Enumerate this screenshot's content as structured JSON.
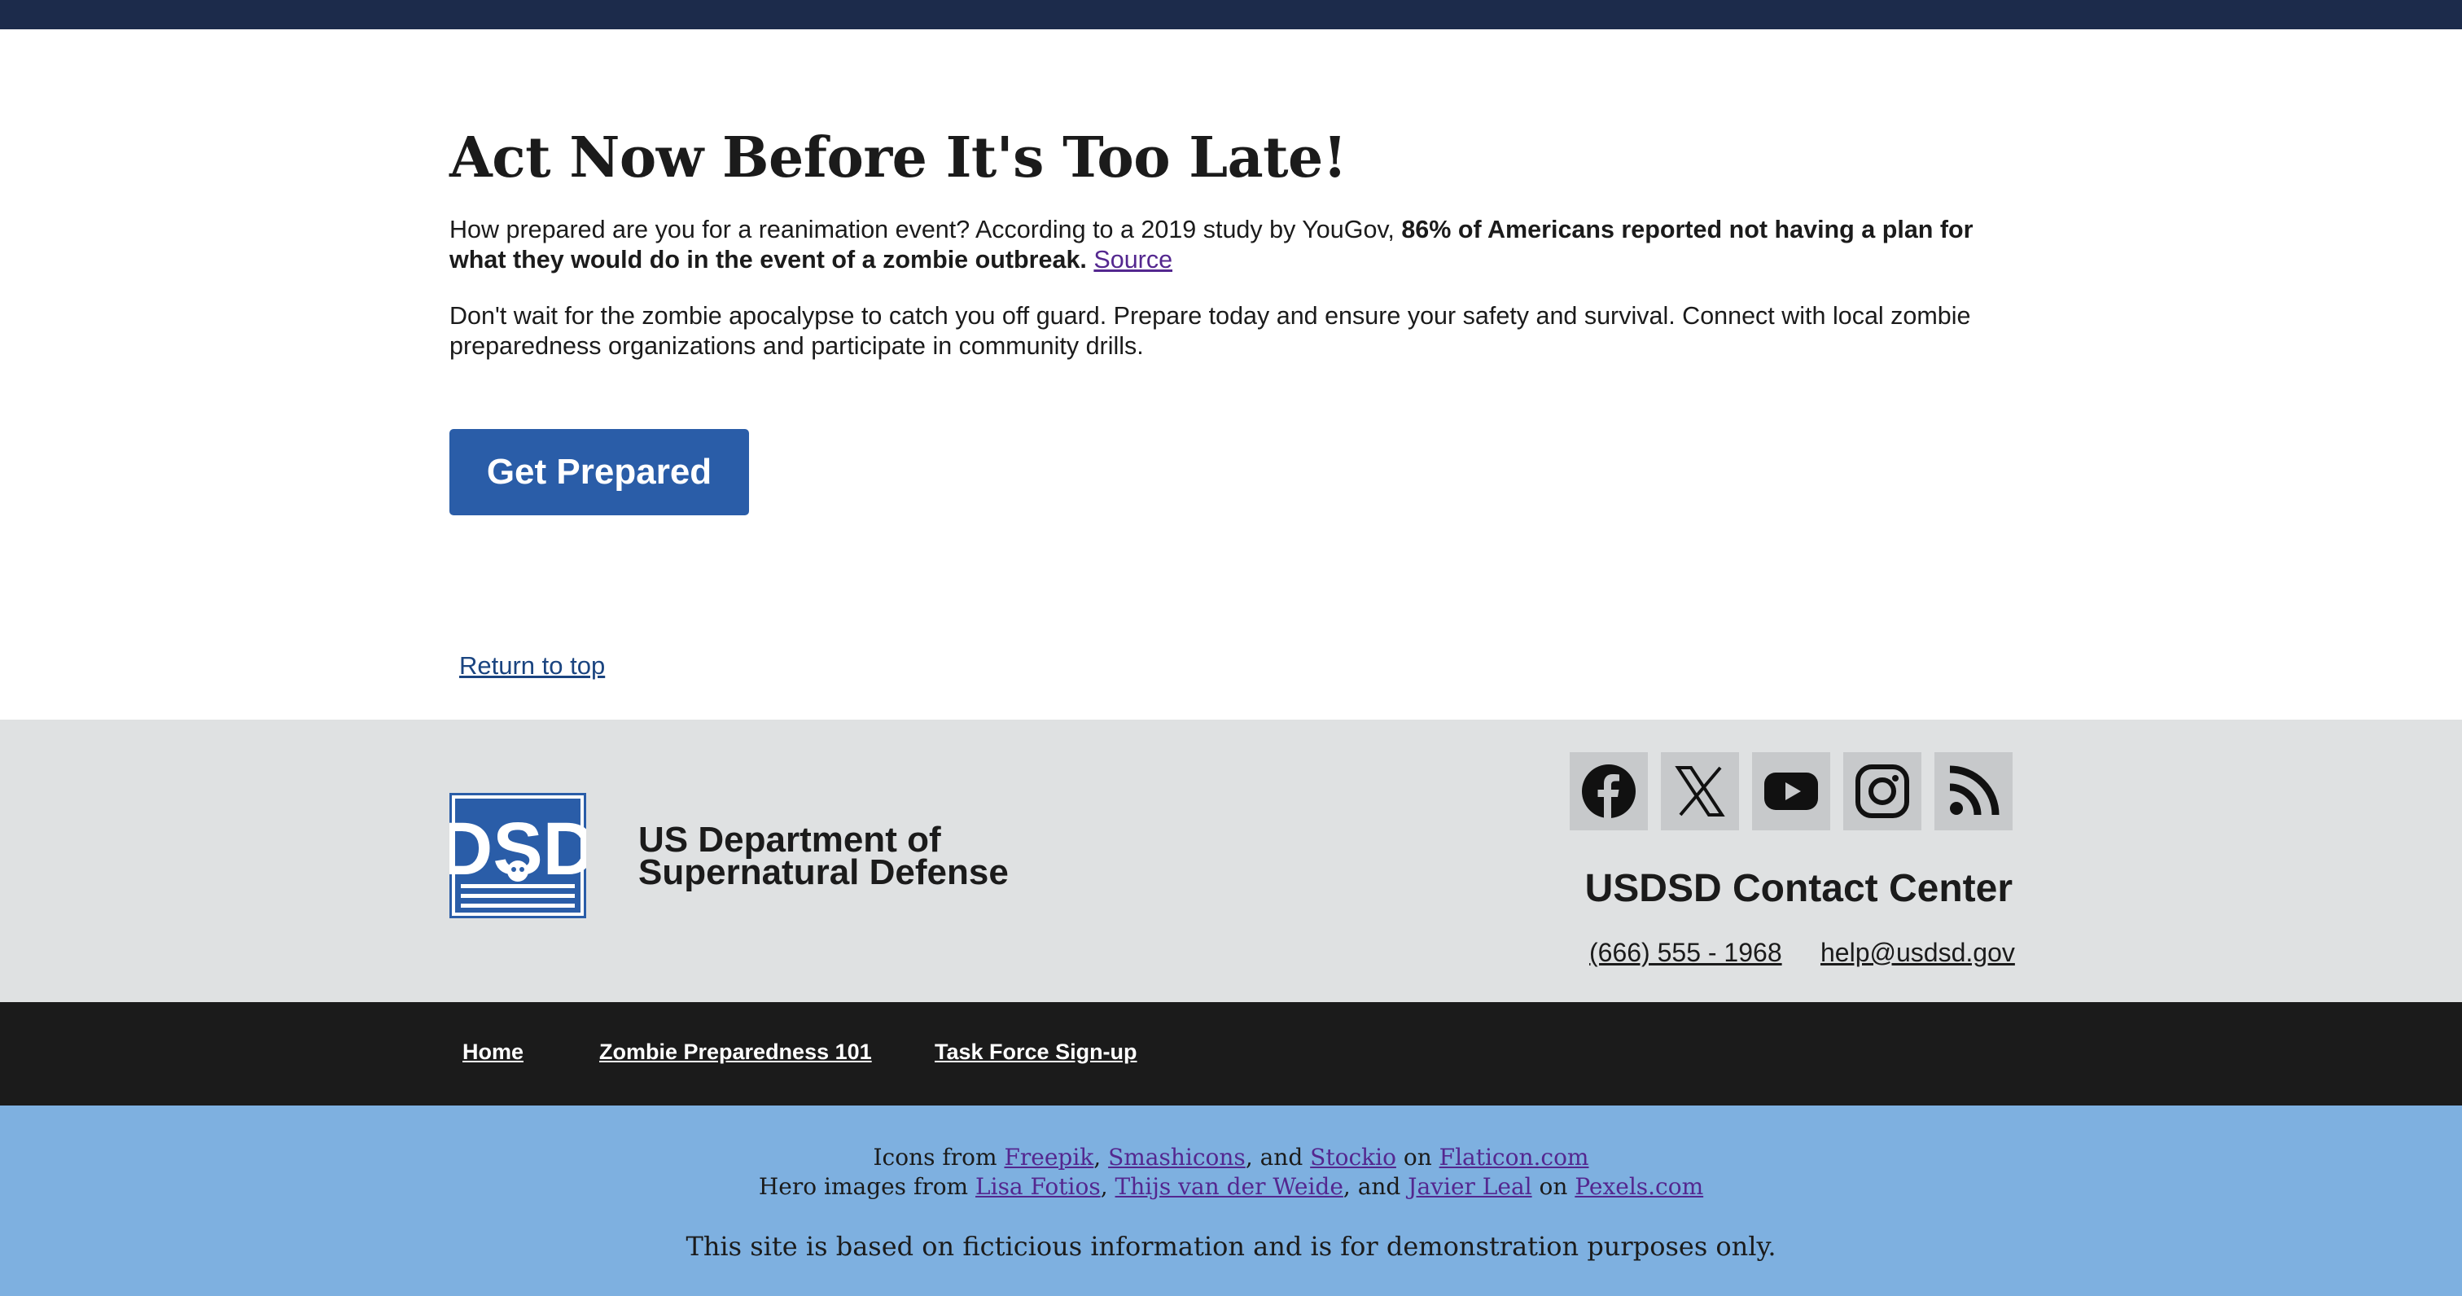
{
  "main": {
    "headline": "Act Now Before It's Too Late!",
    "para1_intro": "How prepared are you for a reanimation event? According to a 2019 study by YouGov, ",
    "para1_bold": "86% of Americans reported not having a plan for what they would do in the event of a zombie outbreak.",
    "para1_link": "Source",
    "para2": "Don't wait for the zombie apocalypse to catch you off guard. Prepare today and ensure your safety and survival. Connect with local zombie preparedness organizations and participate in community drills.",
    "cta_label": "Get Prepared",
    "return_to_top": "Return to top"
  },
  "footer": {
    "logo_text": "DSD",
    "agency_line1": "US Department of",
    "agency_line2": "Supernatural Defense",
    "social_icons": [
      "facebook-icon",
      "x-icon",
      "youtube-icon",
      "instagram-icon",
      "rss-icon"
    ],
    "contact_heading": "USDSD Contact Center",
    "phone": "(666) 555 - 1968",
    "email": "help@usdsd.gov"
  },
  "nav": {
    "home": "Home",
    "zombie_101": "Zombie Preparedness 101",
    "task_force": "Task Force Sign-up"
  },
  "credits": {
    "icons_prefix": "Icons from ",
    "icons_link1": "Freepik",
    "icons_link2": "Smashicons",
    "icons_and": ", and ",
    "icons_link3": "Stockio",
    "icons_on": " on ",
    "icons_site": "Flaticon.com",
    "hero_prefix": "Hero images from ",
    "hero_link1": "Lisa Fotios",
    "hero_link2": "Thijs van der Weide",
    "hero_and": ", and ",
    "hero_link3": "Javier Leal",
    "hero_on": " on ",
    "hero_site": "Pexels.com",
    "comma": ", ",
    "disclaimer": "This site is based on ficticious information and is for demonstration purposes only."
  },
  "colors": {
    "top_bar": "#1c2b4b",
    "cta": "#2a5da8",
    "footer_gray": "#dfe1e2",
    "footer_nav": "#1b1b1b",
    "footer_credits": "#7eb0e0",
    "visited_link": "#54278f"
  }
}
